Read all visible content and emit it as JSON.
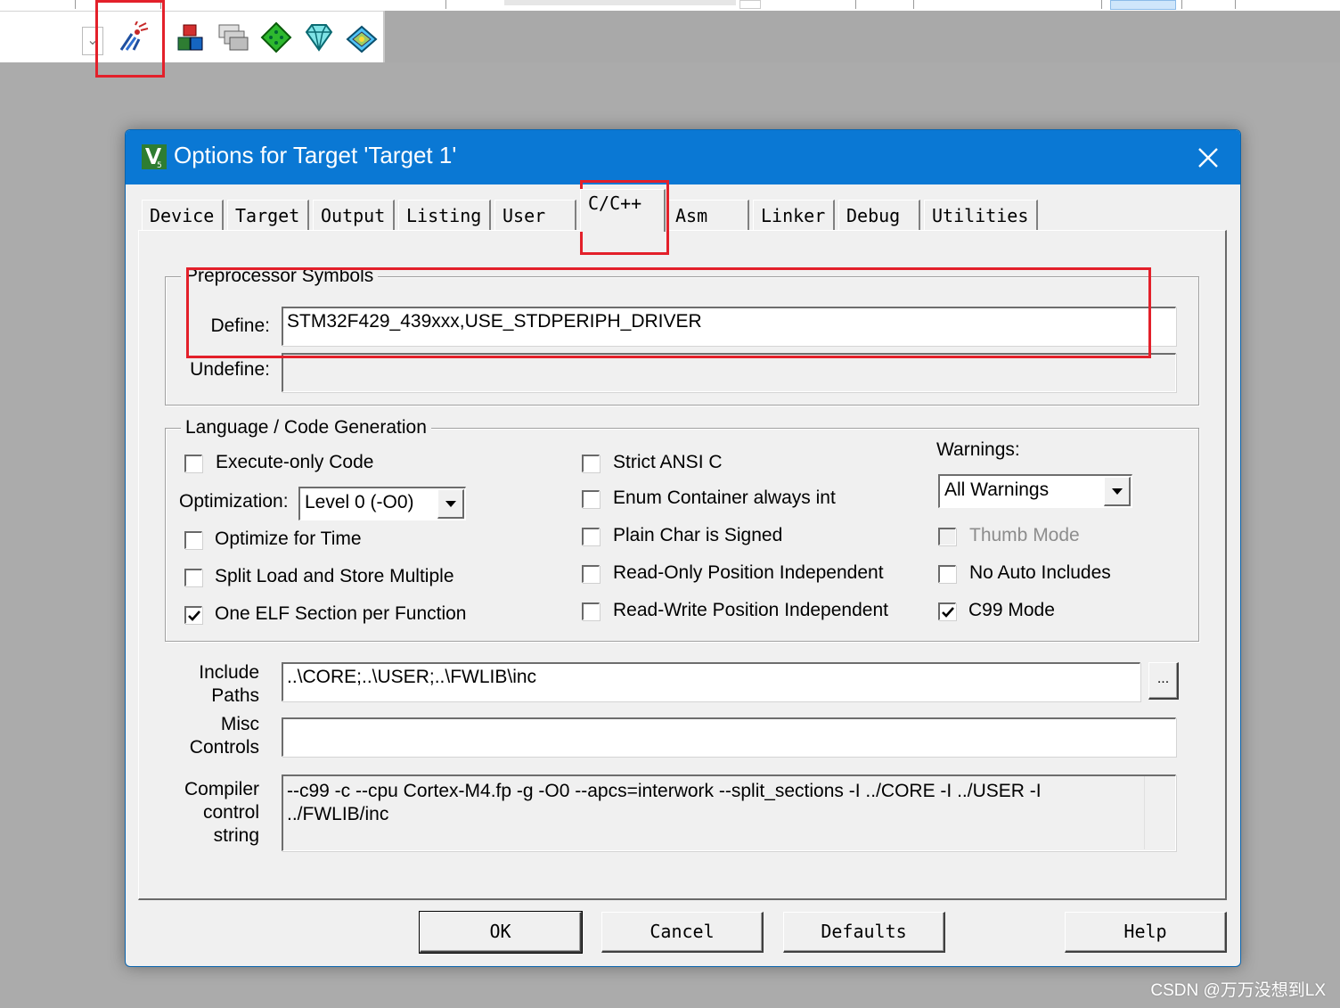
{
  "dialog": {
    "title": "Options for Target 'Target 1'",
    "tabs": [
      "Device",
      "Target",
      "Output",
      "Listing",
      "User",
      "C/C++",
      "Asm",
      "Linker",
      "Debug",
      "Utilities"
    ],
    "active_tab": "C/C++"
  },
  "preprocessor": {
    "group_label": "Preprocessor Symbols",
    "define_label": "Define:",
    "define_value": "STM32F429_439xxx,USE_STDPERIPH_DRIVER",
    "undefine_label": "Undefine:",
    "undefine_value": ""
  },
  "language": {
    "group_label": "Language / Code Generation",
    "execute_only": {
      "label": "Execute-only Code",
      "checked": false
    },
    "optimization_label": "Optimization:",
    "optimization_value": "Level 0 (-O0)",
    "optimize_time": {
      "label": "Optimize for Time",
      "checked": false
    },
    "split_load": {
      "label": "Split Load and Store Multiple",
      "checked": false
    },
    "one_elf": {
      "label": "One ELF Section per Function",
      "checked": true
    },
    "strict_ansi": {
      "label": "Strict ANSI C",
      "checked": false
    },
    "enum_container": {
      "label": "Enum Container always int",
      "checked": false
    },
    "plain_char": {
      "label": "Plain Char is Signed",
      "checked": false
    },
    "ro_pi": {
      "label": "Read-Only Position Independent",
      "checked": false
    },
    "rw_pi": {
      "label": "Read-Write Position Independent",
      "checked": false
    },
    "warnings_label": "Warnings:",
    "warnings_value": "All Warnings",
    "thumb_mode": {
      "label": "Thumb Mode",
      "checked": false,
      "disabled": true
    },
    "no_auto_includes": {
      "label": "No Auto Includes",
      "checked": false
    },
    "c99_mode": {
      "label": "C99 Mode",
      "checked": true
    }
  },
  "paths": {
    "include_label_1": "Include",
    "include_label_2": "Paths",
    "include_value": "..\\CORE;..\\USER;..\\FWLIB\\inc",
    "browse_label": "...",
    "misc_label_1": "Misc",
    "misc_label_2": "Controls",
    "misc_value": "",
    "compiler_label_1": "Compiler",
    "compiler_label_2": "control",
    "compiler_label_3": "string",
    "compiler_line_1": "--c99 -c --cpu Cortex-M4.fp -g -O0 --apcs=interwork --split_sections -I ../CORE -I ../USER -I",
    "compiler_line_2": "../FWLIB/inc"
  },
  "buttons": {
    "ok": "OK",
    "cancel": "Cancel",
    "defaults": "Defaults",
    "help": "Help"
  },
  "watermark": "CSDN @万万没想到LX",
  "colors": {
    "title_bar": "#0a78d4",
    "highlight": "#e3202a",
    "background": "#ababab"
  }
}
